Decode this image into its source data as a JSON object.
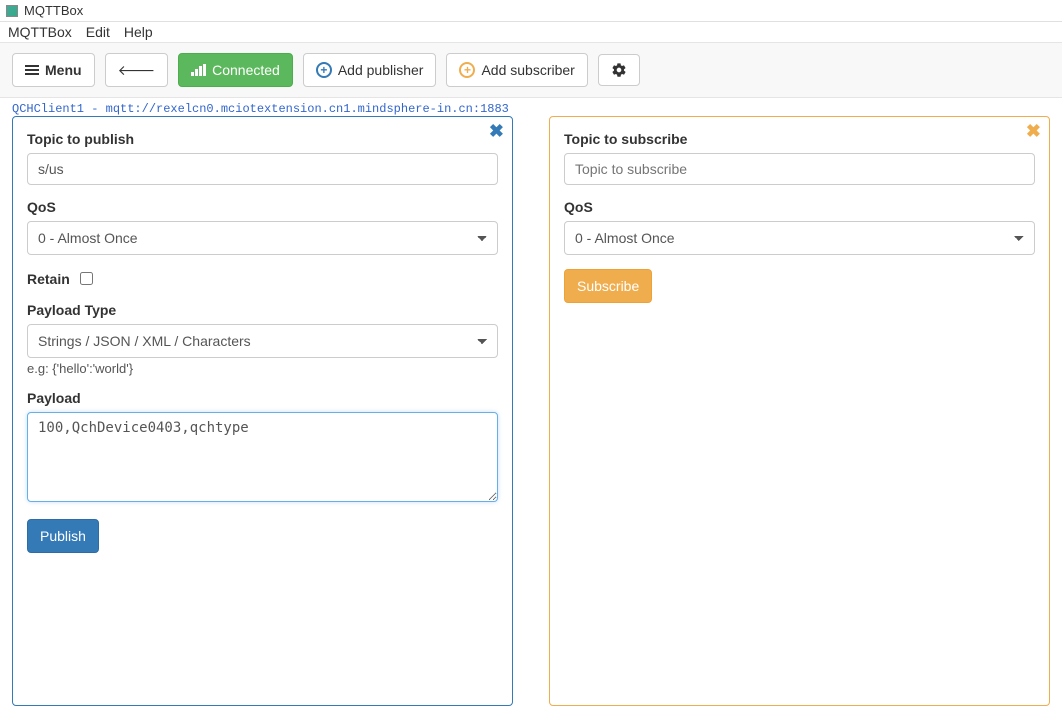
{
  "window": {
    "title": "MQTTBox"
  },
  "menubar": {
    "app": "MQTTBox",
    "edit": "Edit",
    "help": "Help"
  },
  "toolbar": {
    "menu_label": "Menu",
    "connected_label": "Connected",
    "add_publisher_label": "Add publisher",
    "add_subscriber_label": "Add subscriber"
  },
  "connection": "QCHClient1 - mqtt://rexelcn0.mciotextension.cn1.mindsphere-in.cn:1883",
  "publish": {
    "topic_label": "Topic to publish",
    "topic_value": "s/us",
    "qos_label": "QoS",
    "qos_value": "0 - Almost Once",
    "retain_label": "Retain",
    "payload_type_label": "Payload Type",
    "payload_type_value": "Strings / JSON / XML / Characters",
    "payload_type_hint": "e.g: {'hello':'world'}",
    "payload_label": "Payload",
    "payload_value": "100,QchDevice0403,qchtype",
    "publish_button": "Publish"
  },
  "subscribe": {
    "topic_label": "Topic to subscribe",
    "topic_placeholder": "Topic to subscribe",
    "qos_label": "QoS",
    "qos_value": "0 - Almost Once",
    "subscribe_button": "Subscribe"
  }
}
